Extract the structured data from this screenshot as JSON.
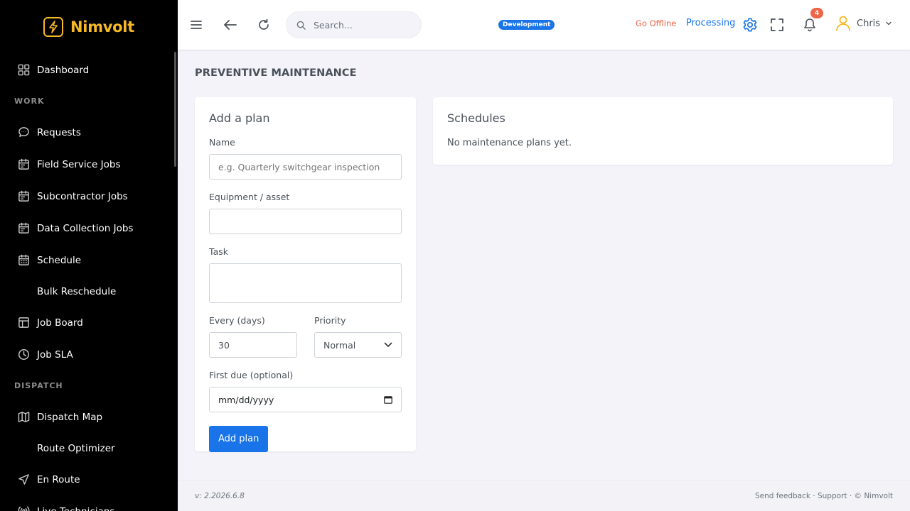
{
  "brand": {
    "name": "Nimvolt",
    "accent": "#f7b924"
  },
  "sidebar": {
    "items": [
      {
        "type": "item",
        "label": "Dashboard",
        "icon": "grid-icon"
      },
      {
        "type": "title",
        "label": "WORK"
      },
      {
        "type": "item",
        "label": "Requests",
        "icon": "chat-bubble-icon"
      },
      {
        "type": "item",
        "label": "Field Service Jobs",
        "icon": "calendar-icon"
      },
      {
        "type": "item",
        "label": "Subcontractor Jobs",
        "icon": "calendar-icon"
      },
      {
        "type": "item",
        "label": "Data Collection Jobs",
        "icon": "calendar-icon"
      },
      {
        "type": "item",
        "label": "Schedule",
        "icon": "calendar-grid-icon"
      },
      {
        "type": "sub",
        "label": "Bulk Reschedule"
      },
      {
        "type": "item",
        "label": "Job Board",
        "icon": "board-icon"
      },
      {
        "type": "item",
        "label": "Job SLA",
        "icon": "clock-icon"
      },
      {
        "type": "title",
        "label": "DISPATCH"
      },
      {
        "type": "item",
        "label": "Dispatch Map",
        "icon": "map-icon"
      },
      {
        "type": "sub",
        "label": "Route Optimizer"
      },
      {
        "type": "item",
        "label": "En Route",
        "icon": "navigation-icon"
      },
      {
        "type": "item",
        "label": "Live Technicians",
        "icon": "broadcast-icon"
      }
    ]
  },
  "topbar": {
    "search_placeholder": "Search...",
    "env_badge": "Development",
    "go_offline": "Go Offline",
    "processing": "Processing",
    "notification_count": "4",
    "user_name": "Chris",
    "primary_color": "#1874e8",
    "danger_color": "#f06548"
  },
  "page": {
    "title": "PREVENTIVE MAINTENANCE"
  },
  "add_plan": {
    "heading": "Add a plan",
    "name_label": "Name",
    "name_placeholder": "e.g. Quarterly switchgear inspection",
    "equipment_label": "Equipment / asset",
    "task_label": "Task",
    "every_label": "Every (days)",
    "every_value": "30",
    "priority_label": "Priority",
    "priority_value": "Normal",
    "first_due_label": "First due (optional)",
    "first_due_placeholder": "mm/dd/yyyy",
    "submit_label": "Add plan"
  },
  "schedules": {
    "heading": "Schedules",
    "empty_text": "No maintenance plans yet."
  },
  "footer": {
    "version": "v: 2.2026.6.8",
    "links": "Send feedback · Support · © Nimvolt"
  }
}
